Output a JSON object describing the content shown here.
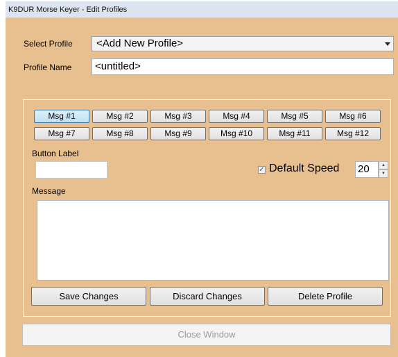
{
  "window": {
    "title": "K9DUR Morse Keyer - Edit Profiles"
  },
  "profile": {
    "select_label": "Select Profile",
    "selected": "<Add New Profile>",
    "name_label": "Profile Name",
    "name_value": "<untitled>"
  },
  "messages": {
    "buttons": [
      "Msg #1",
      "Msg #2",
      "Msg #3",
      "Msg #4",
      "Msg #5",
      "Msg #6",
      "Msg #7",
      "Msg #8",
      "Msg #9",
      "Msg #10",
      "Msg #11",
      "Msg #12"
    ],
    "selected_index": 0,
    "button_label_caption": "Button Label",
    "button_label_value": "",
    "default_speed_label": "Default Speed",
    "default_speed_checked": true,
    "speed_value": "20",
    "message_caption": "Message",
    "message_value": ""
  },
  "actions": {
    "save": "Save Changes",
    "discard": "Discard Changes",
    "delete": "Delete Profile",
    "close": "Close Window"
  }
}
